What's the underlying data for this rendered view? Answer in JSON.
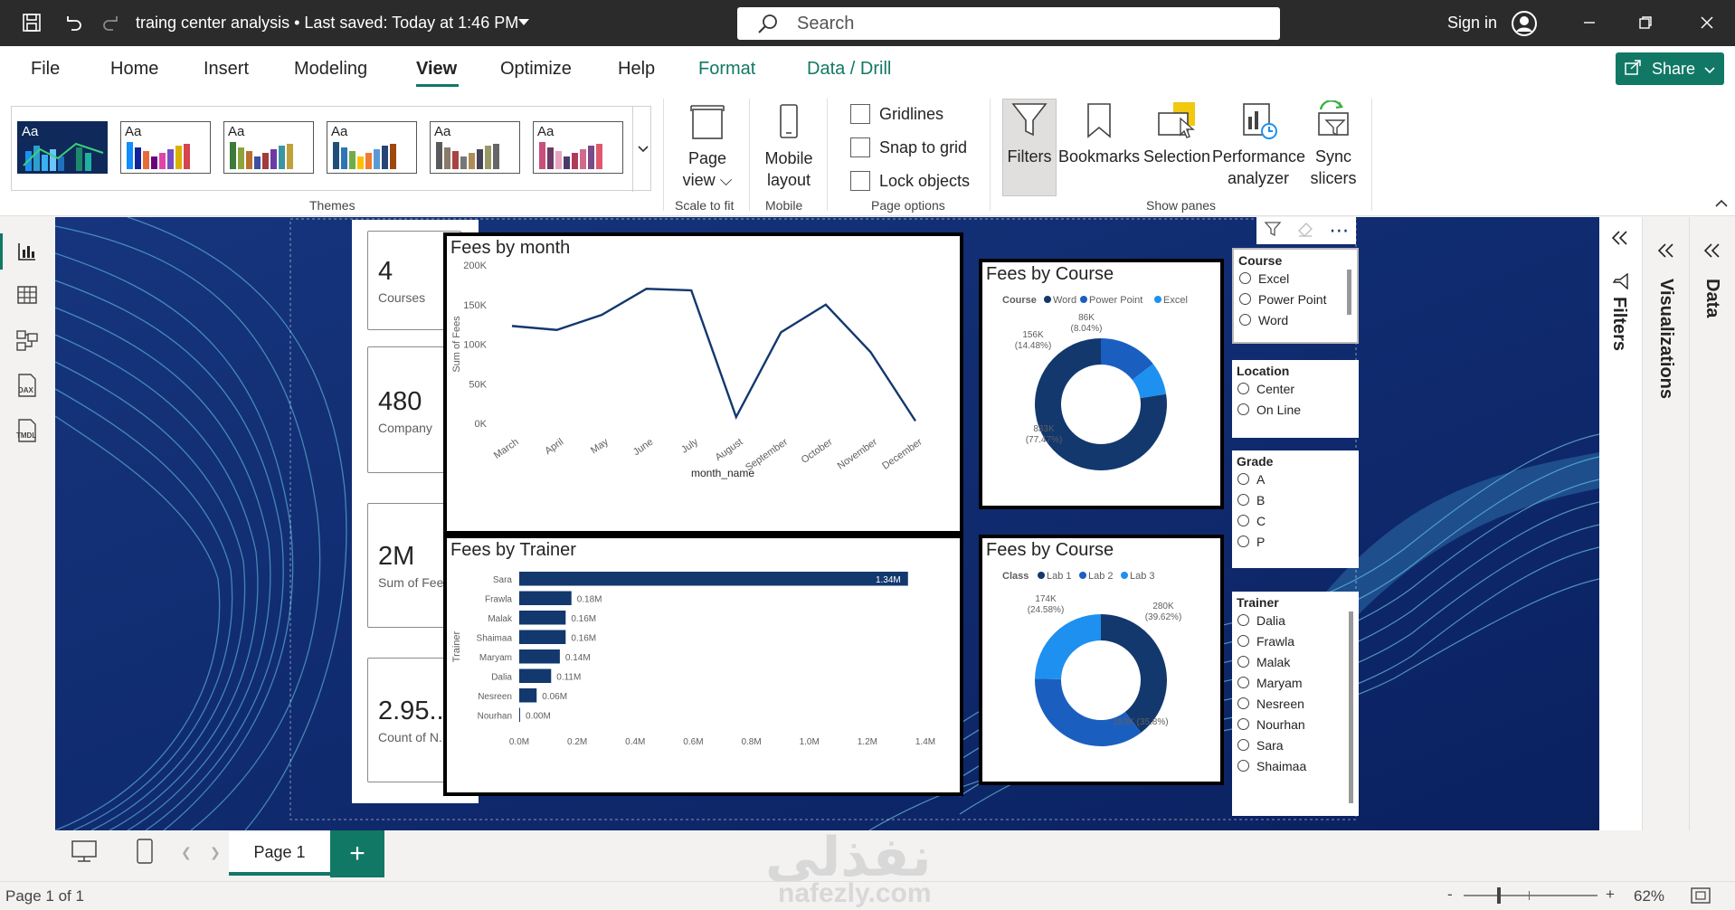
{
  "titlebar": {
    "doc_title": "traing center analysis • Last saved: Today at 1:46 PM",
    "search_placeholder": "Search",
    "signin": "Sign in"
  },
  "menu": {
    "items": [
      "File",
      "Home",
      "Insert",
      "Modeling",
      "View",
      "Optimize",
      "Help"
    ],
    "contextual": [
      "Format",
      "Data / Drill"
    ],
    "active": "View",
    "share": "Share"
  },
  "ribbon": {
    "themes_label": "Themes",
    "theme_sample": "Aa",
    "page_view_line1": "Page",
    "page_view_line2": "view",
    "scale_to_fit": "Scale to fit",
    "mobile_line1": "Mobile",
    "mobile_line2": "layout",
    "mobile_label": "Mobile",
    "gridlines": "Gridlines",
    "snap": "Snap to grid",
    "lock": "Lock objects",
    "page_options": "Page options",
    "filters": "Filters",
    "bookmarks": "Bookmarks",
    "selection": "Selection",
    "perf_line1": "Performance",
    "perf_line2": "analyzer",
    "sync_line1": "Sync",
    "sync_line2": "slicers",
    "show_panes": "Show panes"
  },
  "kpis": [
    {
      "value": "4",
      "label": "Courses"
    },
    {
      "value": "480",
      "label": "Company"
    },
    {
      "value": "2M",
      "label": "Sum of Fees"
    },
    {
      "value": "2.95...",
      "label": "Count of N..."
    }
  ],
  "visual_titles": {
    "fees_month": "Fees by month",
    "fees_trainer": "Fees by Trainer",
    "fees_course": "Fees by Course",
    "fees_class": "Fees by Course"
  },
  "chart_data": [
    {
      "type": "line",
      "title": "Fees by month",
      "xlabel": "month_name",
      "ylabel": "Sum of Fees",
      "categories": [
        "March",
        "April",
        "May",
        "June",
        "July",
        "August",
        "September",
        "October",
        "November",
        "December"
      ],
      "values": [
        123000,
        118000,
        137000,
        170000,
        168000,
        8000,
        115000,
        150000,
        90000,
        3000
      ],
      "yticks": [
        "0K",
        "50K",
        "100K",
        "150K",
        "200K"
      ],
      "ylim": [
        0,
        200000
      ],
      "color": "#12386e"
    },
    {
      "type": "bar",
      "title": "Fees by Trainer",
      "ylabel": "Trainer",
      "categories": [
        "Sara",
        "Frawla",
        "Malak",
        "Shaimaa",
        "Maryam",
        "Dalia",
        "Nesreen",
        "Nourhan"
      ],
      "values": [
        1.34,
        0.18,
        0.16,
        0.16,
        0.14,
        0.11,
        0.06,
        0.0
      ],
      "labels": [
        "1.34M",
        "0.18M",
        "0.16M",
        "0.16M",
        "0.14M",
        "0.11M",
        "0.06M",
        "0.00M"
      ],
      "xticks": [
        "0.0M",
        "0.2M",
        "0.4M",
        "0.6M",
        "0.8M",
        "1.0M",
        "1.2M",
        "1.4M"
      ],
      "xlim": [
        0,
        1.4
      ],
      "color": "#12386e"
    },
    {
      "type": "pie",
      "title": "Fees by Course",
      "legend_title": "Course",
      "series": [
        {
          "name": "Word",
          "value": 833,
          "label": "833K",
          "pct": "(77.47%)",
          "color": "#12386e"
        },
        {
          "name": "Power Point",
          "value": 156,
          "label": "156K",
          "pct": "(14.48%)",
          "color": "#1a5fc0"
        },
        {
          "name": "Excel",
          "value": 86,
          "label": "86K",
          "pct": "(8.04%)",
          "color": "#1e90ef"
        }
      ]
    },
    {
      "type": "pie",
      "title": "Fees by Course",
      "legend_title": "Class",
      "series": [
        {
          "name": "Lab 1",
          "value": 280,
          "label": "280K",
          "pct": "(39.62%)",
          "color": "#12386e"
        },
        {
          "name": "Lab 2",
          "value": 253,
          "label": "253K (35.8%)",
          "pct": "",
          "color": "#1a5fc0"
        },
        {
          "name": "Lab 3",
          "value": 174,
          "label": "174K",
          "pct": "(24.58%)",
          "color": "#1e90ef"
        }
      ]
    }
  ],
  "slicers": {
    "course": {
      "title": "Course",
      "options": [
        "Excel",
        "Power Point",
        "Word"
      ]
    },
    "location": {
      "title": "Location",
      "options": [
        "Center",
        "On Line"
      ]
    },
    "grade": {
      "title": "Grade",
      "options": [
        "A",
        "B",
        "C",
        "P"
      ]
    },
    "trainer": {
      "title": "Trainer",
      "options": [
        "Dalia",
        "Frawla",
        "Malak",
        "Maryam",
        "Nesreen",
        "Nourhan",
        "Sara",
        "Shaimaa"
      ]
    }
  },
  "panes": {
    "filters": "Filters",
    "visualizations": "Visualizations",
    "data": "Data"
  },
  "pages": {
    "tab": "Page 1",
    "status": "Page 1 of 1",
    "zoom": "62%"
  },
  "watermark": {
    "arabic": "نفذلي",
    "latin": "nafezly.com"
  }
}
